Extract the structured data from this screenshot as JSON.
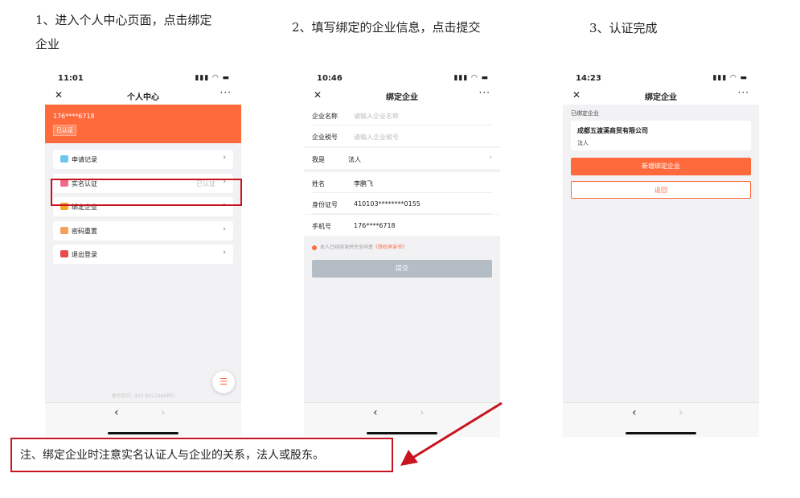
{
  "colors": {
    "accent": "#ff6a3d",
    "disabled_btn": "#b4bcc6",
    "annotation": "#c8141e"
  },
  "steps": [
    {
      "line1": "1、进入个人中心页面，点击绑定",
      "line2": "企业"
    },
    {
      "line1": "2、填写绑定的企业信息，点击提交"
    },
    {
      "line1": "3、认证完成"
    }
  ],
  "phone1": {
    "time": "11:01",
    "status_icons": "▮▮▮ ◠ ▬",
    "nav": {
      "close": "✕",
      "title": "个人中心",
      "more": "···"
    },
    "banner": {
      "phone": "176****6718",
      "badge": "已认证"
    },
    "menu": [
      {
        "label": "申请记录",
        "status": "",
        "arrow": "›",
        "icon": "record-icon",
        "color": "#6ec6f0"
      },
      {
        "label": "实名认证",
        "status": "已认证",
        "arrow": "›",
        "icon": "id-card-icon",
        "color": "#f06a8a"
      },
      {
        "label": "绑定企业",
        "status": "",
        "arrow": "›",
        "icon": "company-icon",
        "color": "#f5a623"
      },
      {
        "label": "密码重置",
        "status": "",
        "arrow": "›",
        "icon": "password-icon",
        "color": "#f5a05a"
      },
      {
        "label": "退出登录",
        "status": "",
        "arrow": "›",
        "icon": "power-icon",
        "color": "#e94c4c"
      }
    ],
    "fab": "☰",
    "contact": "联系我们: 400-8012366转0",
    "bottom": {
      "back": "‹",
      "forward": "›"
    }
  },
  "phone2": {
    "time": "10:46",
    "status_icons": "▮▮▮ ◠ ▬",
    "nav": {
      "close": "✕",
      "title": "绑定企业",
      "more": "···"
    },
    "rows": [
      {
        "label": "企业名称",
        "value": "",
        "placeholder": "请输入企业名称"
      },
      {
        "label": "企业税号",
        "value": "",
        "placeholder": "请输入企业税号"
      },
      {
        "label": "我是",
        "value": "法人",
        "arrow": "›"
      },
      {
        "label": "姓名",
        "value": "李鹏飞"
      },
      {
        "label": "身份证号",
        "value": "410103********0155"
      },
      {
        "label": "手机号",
        "value": "176****6718"
      }
    ],
    "agree_text": "本人已经阅读并完全同意",
    "agree_link": "《授权承诺书》",
    "submit": "提交",
    "bottom": {
      "back": "‹",
      "forward": "›"
    }
  },
  "phone3": {
    "time": "14:23",
    "status_icons": "▮▮▮ ◠ ▬",
    "nav": {
      "close": "✕",
      "title": "绑定企业",
      "more": "···"
    },
    "bound_label": "已绑定企业",
    "company_name": "成都五渡溪商贸有限公司",
    "company_role": "法人",
    "add_button": "新增绑定企业",
    "back_button": "返回",
    "bottom": {
      "back": "‹",
      "forward": "›"
    }
  },
  "note": "注、绑定企业时注意实名认证人与企业的关系，法人或股东。"
}
